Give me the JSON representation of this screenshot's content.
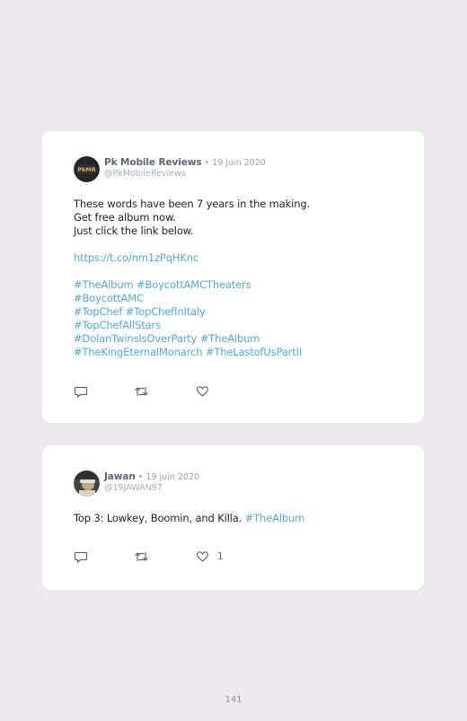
{
  "tweets": [
    {
      "author": "Pk Mobile Reviews",
      "date": " • 19 juin 2020",
      "handle": "@PkMobileReviews",
      "avatar_text": "PkMR",
      "lines": [
        "These words have been 7 years in the making.",
        "Get free album now.",
        "Just click the link below."
      ],
      "link": "https://t.co/nm1zPqHKnc",
      "hashtag_lines": [
        "#TheAlbum #BoycottAMCTheaters",
        "#BoycottAMC",
        "#TopChef #TopChefInItaly",
        "#TopChefAllStars",
        "#DolanTwinsIsOverParty #TheAlbum",
        "#TheKingEternalMonarch #TheLastofUsPartII"
      ]
    },
    {
      "author": "Jawan",
      "date": " • 19 juin 2020",
      "handle": "@19JAWAN97",
      "text": "Top 3: Lowkey, Boomin, and Killa. ",
      "hashtag": "#TheAlbum",
      "like_count": "1"
    }
  ],
  "icons": [
    "reply-icon",
    "retweet-icon",
    "heart-icon"
  ],
  "colors": {
    "link": "#4fa9e3",
    "background": "#ece8ee",
    "card": "#ffffff"
  },
  "page_number": "141"
}
